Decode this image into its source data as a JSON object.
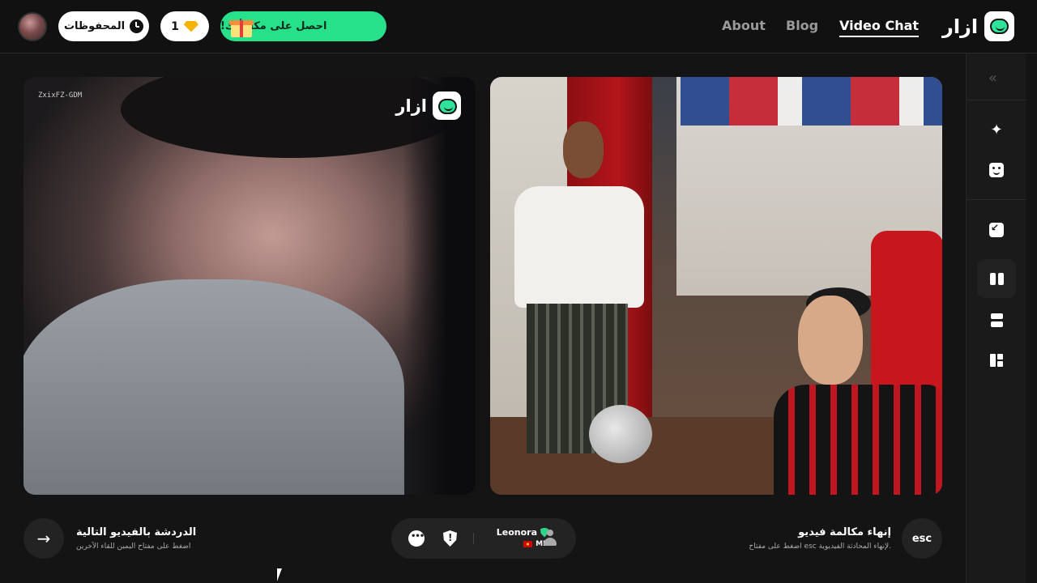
{
  "header": {
    "saved_label": "المحفوظات",
    "gems_count": "1",
    "reward_label": "احصل على مكافأتك!",
    "nav": {
      "about": "About",
      "blog": "Blog",
      "video_chat": "Video Chat"
    },
    "brand_name": "ازار"
  },
  "video_left": {
    "id_label": "ZxixFZ-GDM",
    "watermark": "ازار"
  },
  "controls": {
    "next_title": "الدردشة بالفيديو التالية",
    "next_hint": "اضغط على مفتاح اليمين للقاء الآخرين",
    "partner_name": "Leonora",
    "partner_country": "MK",
    "end_title": "إنهاء مكالمة فيديو",
    "end_hint": "اضغط على مفتاح esc لإنهاء المحادثة الفيديوية.",
    "esc_label": "esc"
  },
  "sidebar": {
    "collapse_icon": "double-chevron-left-icon",
    "tools": [
      "magic-wand-icon",
      "face-filter-icon",
      "shrink-icon",
      "layout-columns-icon",
      "layout-rows-icon",
      "layout-grid-icon"
    ]
  },
  "colors": {
    "accent_green": "#27e08a",
    "background": "#141414",
    "gem": "#f5b400"
  }
}
